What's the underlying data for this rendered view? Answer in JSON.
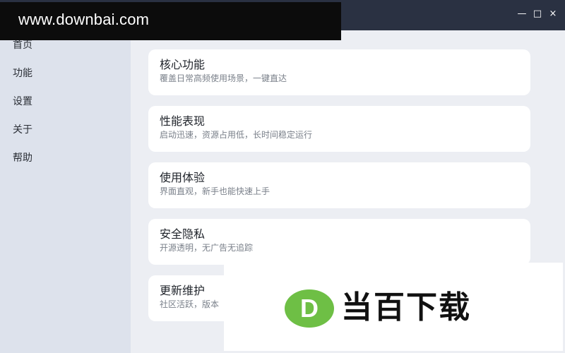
{
  "window": {
    "controls": {
      "minimize": "—",
      "maximize": "□",
      "close": "×"
    }
  },
  "sidebar": {
    "items": [
      {
        "label": "首页"
      },
      {
        "label": "功能"
      },
      {
        "label": "设置"
      },
      {
        "label": "关于"
      },
      {
        "label": "帮助"
      }
    ]
  },
  "cards": [
    {
      "title": "核心功能",
      "desc": "覆盖日常高频使用场景，一键直达"
    },
    {
      "title": "性能表现",
      "desc": "启动迅速，资源占用低，长时间稳定运行"
    },
    {
      "title": "使用体验",
      "desc": "界面直观，新手也能快速上手"
    },
    {
      "title": "安全隐私",
      "desc": "开源透明，无广告无追踪"
    },
    {
      "title": "更新维护",
      "desc": "社区活跃，版本"
    }
  ],
  "watermark": {
    "url": "www.downbai.com",
    "logo_letter": "D",
    "logo_text": "当百下载"
  },
  "colors": {
    "titlebar": "#2a3142",
    "sidebar": "#dde2ec",
    "main_bg": "#eceef3",
    "card_bg": "#ffffff",
    "logo_green": "#6ebf45"
  }
}
